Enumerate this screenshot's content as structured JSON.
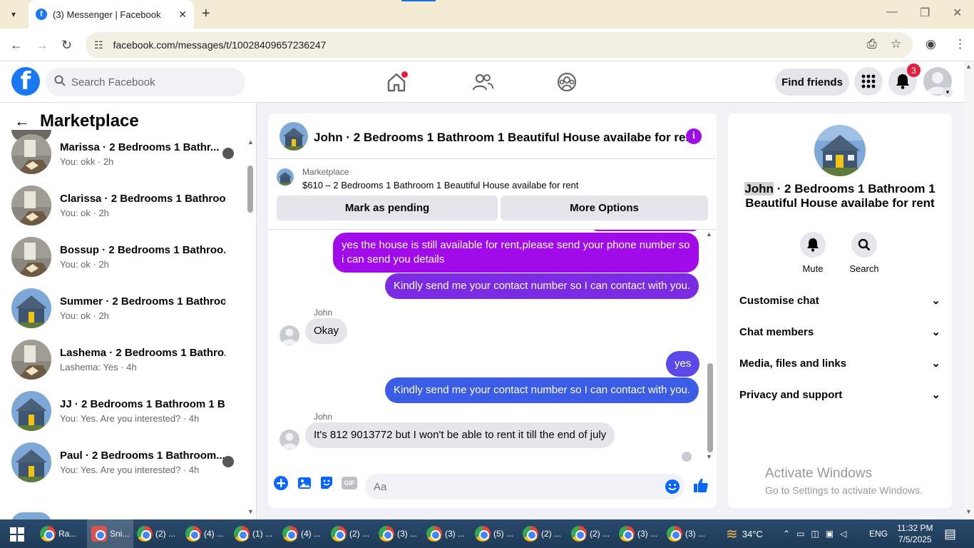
{
  "browser": {
    "tab_title": "(3) Messenger | Facebook",
    "url": "facebook.com/messages/t/10028409657236247"
  },
  "fb_header": {
    "search_placeholder": "Search Facebook",
    "find_friends": "Find friends",
    "notification_count": "3"
  },
  "left": {
    "title": "Marketplace",
    "conversations": [
      {
        "name": "Marissa · 2 Bedrooms 1 Bathr...",
        "snippet": "You: okk · 2h",
        "thumb": "room"
      },
      {
        "name": "Clarissa · 2 Bedrooms 1 Bathroo...",
        "snippet": "You: ok · 2h",
        "thumb": "room"
      },
      {
        "name": "Bossup · 2 Bedrooms 1 Bathroo...",
        "snippet": "You: ok · 2h",
        "thumb": "room"
      },
      {
        "name": "Summer · 2 Bedrooms 1 Bathroo...",
        "snippet": "You: ok · 2h",
        "thumb": "house"
      },
      {
        "name": "Lashema · 2 Bedrooms 1 Bathro...",
        "snippet": "Lashema: Yes · 4h",
        "thumb": "room"
      },
      {
        "name": "JJ · 2 Bedrooms 1 Bathroom 1 Be...",
        "snippet": "You: Yes. Are you interested? · 4h",
        "thumb": "house"
      },
      {
        "name": "Paul · 2 Bedrooms 1 Bathroom...",
        "snippet": "You: Yes. Are you interested? · 4h",
        "thumb": "house"
      }
    ]
  },
  "chat": {
    "title": "John · 2 Bedrooms 1 Bathroom 1 Beautiful House availabe for re...",
    "listing_category": "Marketplace",
    "listing_price": "$610 – 2 Bedrooms 1 Bathroom 1 Beautiful House availabe for rent",
    "mark_pending": "Mark as pending",
    "more_options": "More Options",
    "messages": {
      "m1": "yes the house is still available for rent,please send your  phone number so i can send you details",
      "m2": "Kindly send me your contact number so I can contact with you.",
      "sender1": "John",
      "m3": "Okay",
      "m4": "yes",
      "m5": "Kindly send me your contact number so I can contact with you.",
      "sender2": "John",
      "m6": "It's 812 9013772 but I won't be able to rent it till the end of july"
    },
    "composer_placeholder": "Aa",
    "gif_label": "GIF"
  },
  "right": {
    "name_first": "John",
    "name_rest": " · 2 Bedrooms 1 Bathroom 1 Beautiful House availabe for rent",
    "mute": "Mute",
    "search": "Search",
    "sections": [
      "Customise chat",
      "Chat members",
      "Media, files and links",
      "Privacy and support"
    ],
    "activate_title": "Activate Windows",
    "activate_sub": "Go to Settings to activate Windows."
  },
  "taskbar": {
    "items": [
      "Ra...",
      "Sni...",
      "(2) ...",
      "(4) ...",
      "(1) ...",
      "(4) ...",
      "(2) ...",
      "(3) ...",
      "(3) ...",
      "(5) ...",
      "(2) ...",
      "(2) ...",
      "(3) ...",
      "(3) ..."
    ],
    "temp": "34°C",
    "lang": "ENG",
    "time": "11:32 PM",
    "date": "7/5/2025"
  },
  "colors": {
    "fb_blue": "#1877f2",
    "bubble_purple": "#a20be9",
    "bubble_blue": "#3b5ce6",
    "info_purple": "#a20be9"
  }
}
